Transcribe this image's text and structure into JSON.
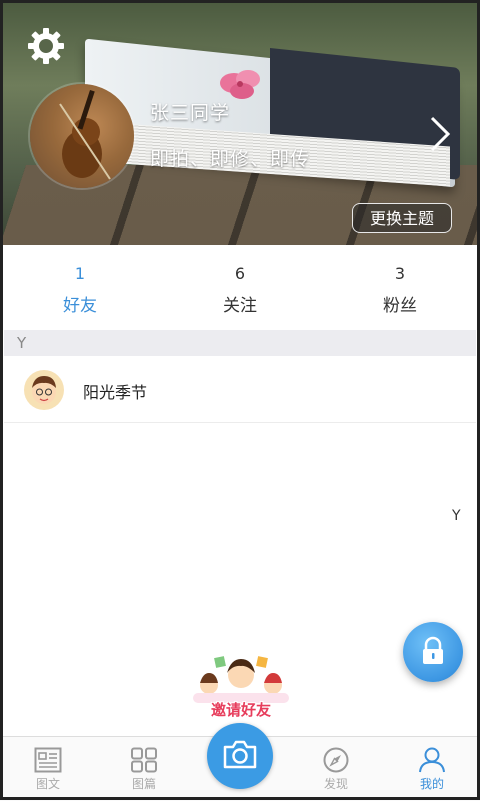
{
  "profile": {
    "name": "张三同学",
    "slogan": "即拍、即修、即传",
    "change_theme": "更换主题"
  },
  "stats": [
    {
      "count": "1",
      "label": "好友",
      "active": true
    },
    {
      "count": "6",
      "label": "关注",
      "active": false
    },
    {
      "count": "3",
      "label": "粉丝",
      "active": false
    }
  ],
  "friends": {
    "section_letter": "Y",
    "items": [
      {
        "name": "阳光季节"
      }
    ]
  },
  "index_bar": {
    "letter": "Y"
  },
  "invite": {
    "label": "邀请好友"
  },
  "nav": {
    "items": [
      {
        "label": "图文",
        "icon": "document-icon",
        "active": false
      },
      {
        "label": "图篇",
        "icon": "grid-icon",
        "active": false
      },
      {
        "label": "",
        "icon": "camera-icon",
        "active": false
      },
      {
        "label": "发现",
        "icon": "compass-icon",
        "active": false
      },
      {
        "label": "我的",
        "icon": "person-icon",
        "active": true
      }
    ]
  },
  "colors": {
    "accent": "#3b8fd9",
    "camera": "#3b9be4",
    "invite_text": "#e73d5c"
  }
}
